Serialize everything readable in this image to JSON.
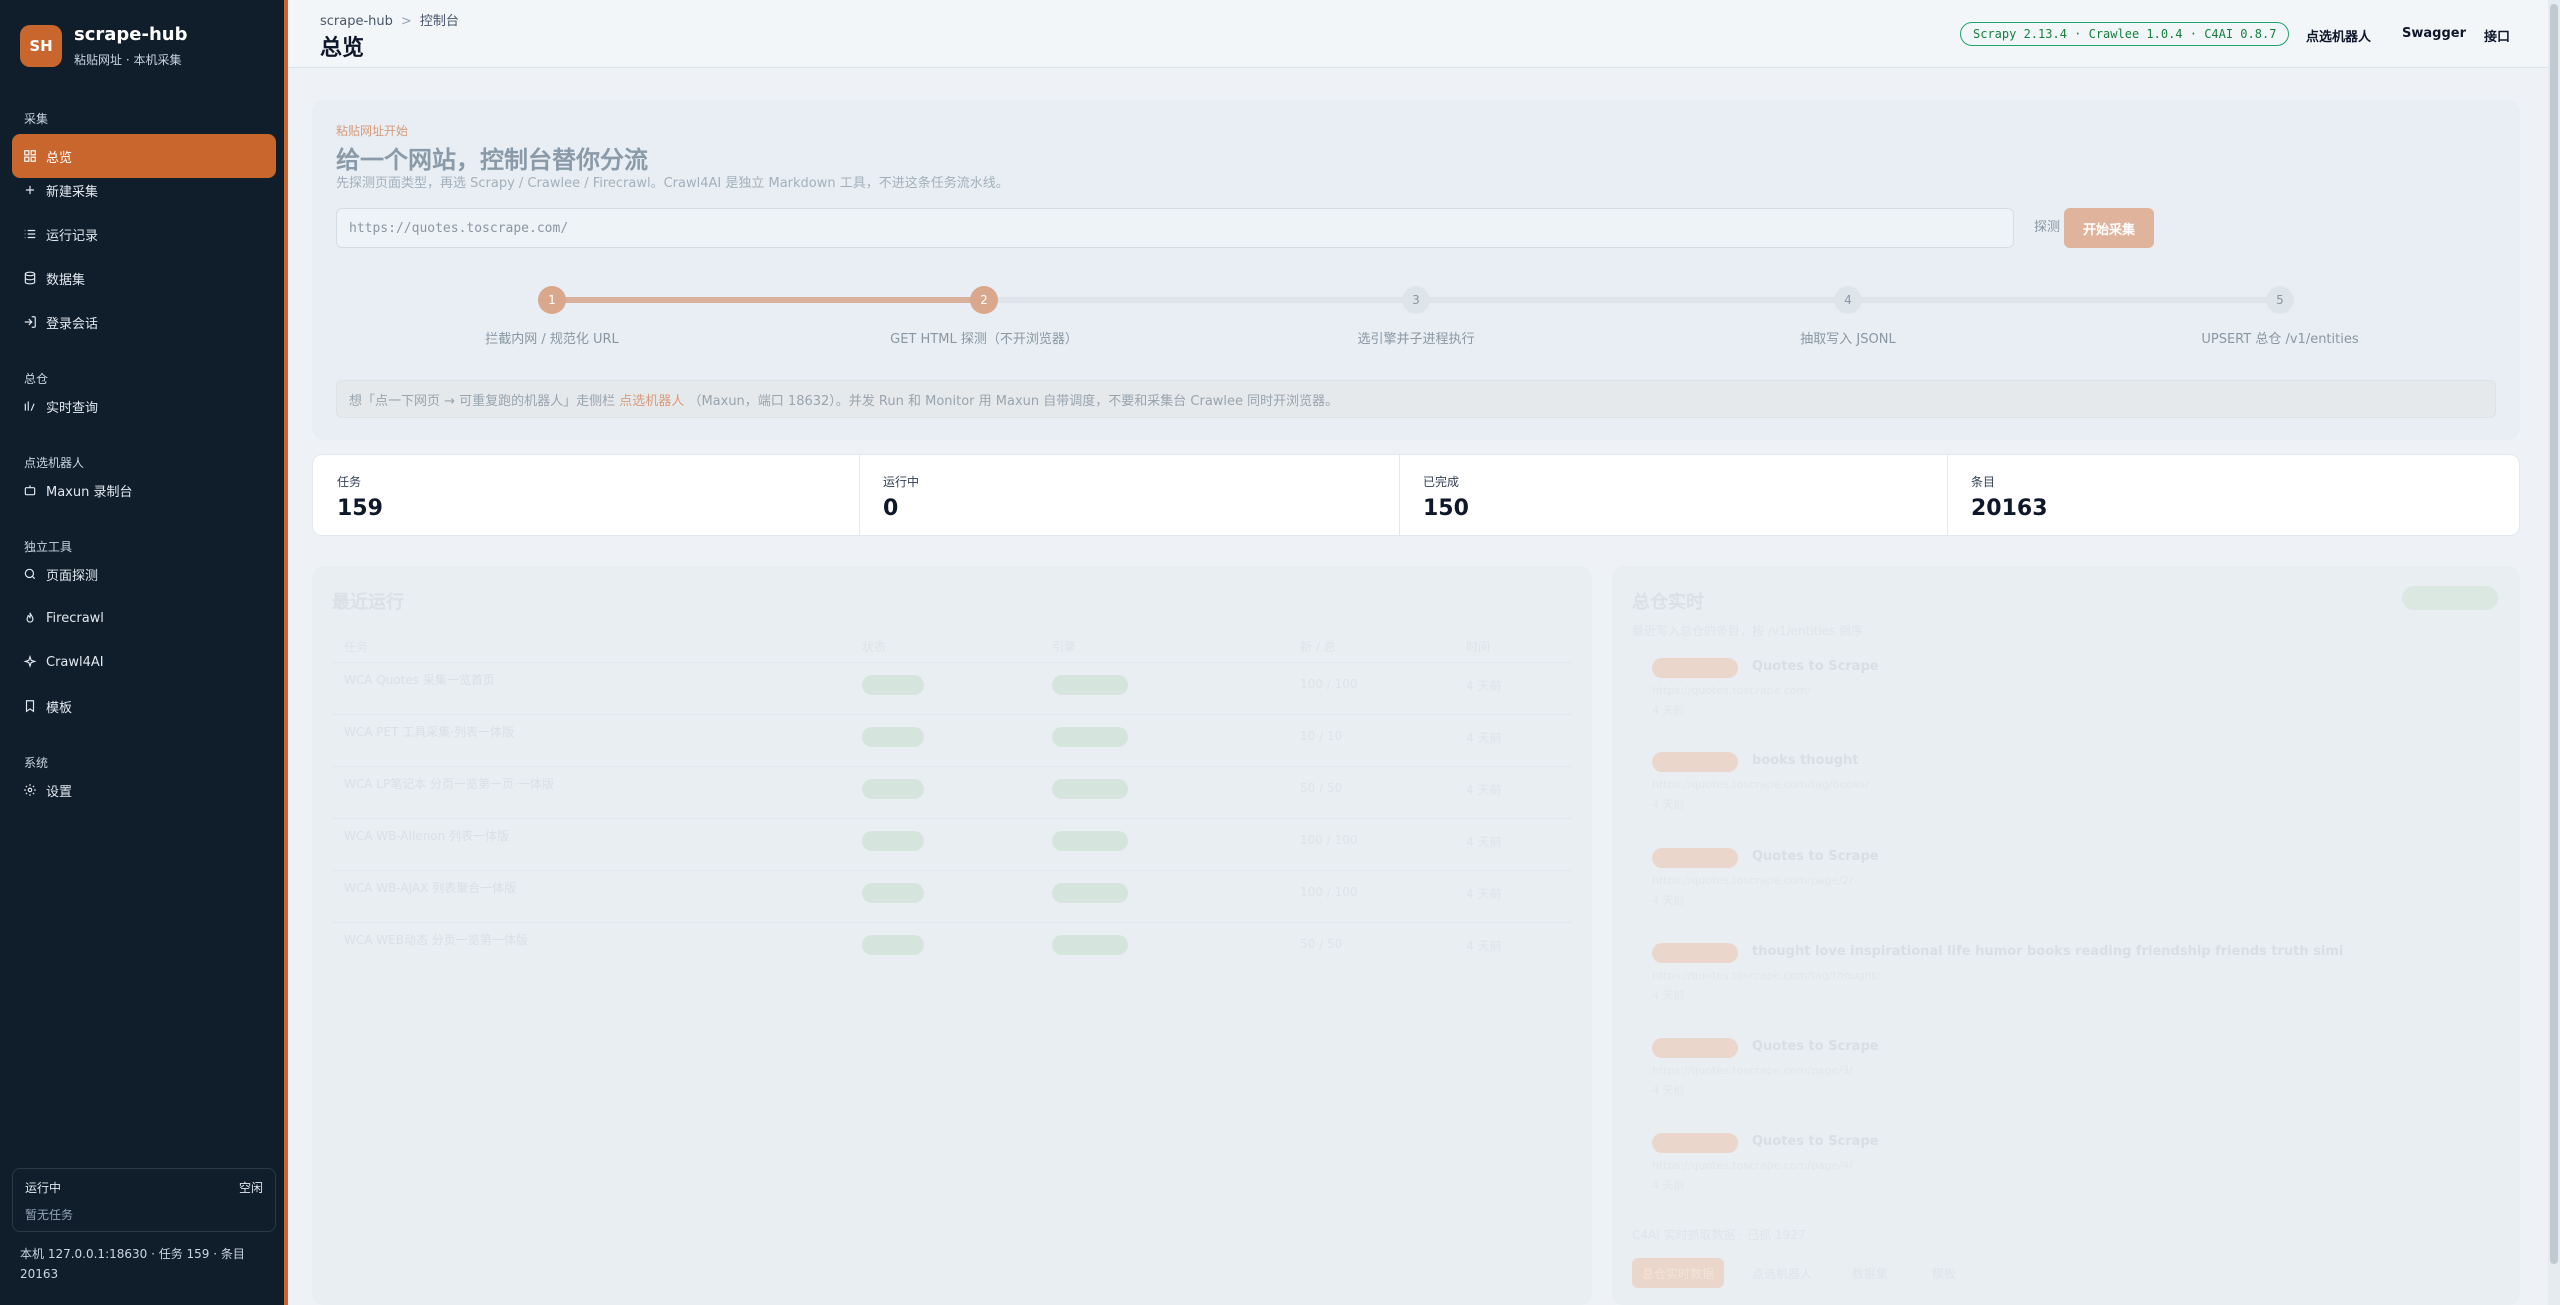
{
  "brand": {
    "logo": "SH",
    "name": "scrape-hub",
    "subtitle": "粘贴网址 · 本机采集"
  },
  "sidebar": {
    "sections": [
      {
        "title": "采集",
        "items": [
          {
            "label": "总览",
            "icon": "dashboard-icon",
            "active": true
          },
          {
            "label": "新建采集",
            "icon": "plus-icon"
          },
          {
            "label": "运行记录",
            "icon": "list-icon"
          },
          {
            "label": "数据集",
            "icon": "database-icon"
          },
          {
            "label": "登录会话",
            "icon": "login-icon"
          }
        ]
      },
      {
        "title": "总仓",
        "items": [
          {
            "label": "实时查询",
            "icon": "stats-icon"
          }
        ]
      },
      {
        "title": "点选机器人",
        "items": [
          {
            "label": "Maxun 录制台",
            "icon": "robot-icon"
          }
        ]
      },
      {
        "title": "独立工具",
        "items": [
          {
            "label": "页面探测",
            "icon": "search-icon"
          },
          {
            "label": "Firecrawl",
            "icon": "flame-icon"
          },
          {
            "label": "Crawl4AI",
            "icon": "sparkle-icon"
          },
          {
            "label": "模板",
            "icon": "bookmark-icon"
          }
        ]
      },
      {
        "title": "系统",
        "items": [
          {
            "label": "设置",
            "icon": "gear-icon"
          }
        ]
      }
    ],
    "running": {
      "label": "运行中",
      "state": "空闲",
      "empty": "暂无任务"
    },
    "footer": "本机 127.0.0.1:18630 · 任务 159 · 条目 20163"
  },
  "topbar": {
    "breadcrumb": [
      "scrape-hub",
      "控制台"
    ],
    "title": "总览",
    "version": "Scrapy 2.13.4 · Crawlee 1.0.4 · C4AI 0.8.7",
    "links": [
      "点选机器人",
      "Swagger",
      "接口"
    ]
  },
  "hero": {
    "kicker": "粘贴网址开始",
    "title": "给一个网站，控制台替你分流",
    "desc": "先探测页面类型，再选 Scrapy / Crawlee / Firecrawl。Crawl4AI 是独立 Markdown 工具，不进这条任务流水线。",
    "url_value": "https://quotes.toscrape.com/",
    "probe_label": "探测",
    "start_label": "开始采集",
    "steps": [
      {
        "n": "1",
        "label": "拦截内网 / 规范化 URL",
        "done": true
      },
      {
        "n": "2",
        "label": "GET HTML 探测（不开浏览器）",
        "done": true
      },
      {
        "n": "3",
        "label": "选引擎并子进程执行",
        "done": false
      },
      {
        "n": "4",
        "label": "抽取写入 JSONL",
        "done": false
      },
      {
        "n": "5",
        "label": "UPSERT 总仓 /v1/entities",
        "done": false
      }
    ],
    "hint_pre": "想「点一下网页 → 可重复跑的机器人」走侧栏 ",
    "hint_link": "点选机器人",
    "hint_post": " （Maxun，端口 18632）。并发 Run 和 Monitor 用 Maxun 自带调度，不要和采集台 Crawlee 同时开浏览器。"
  },
  "stats": [
    {
      "label": "任务",
      "value": "159"
    },
    {
      "label": "运行中",
      "value": "0"
    },
    {
      "label": "已完成",
      "value": "150"
    },
    {
      "label": "条目",
      "value": "20163"
    }
  ],
  "recent": {
    "title": "最近运行",
    "headers": [
      "任务",
      "状态",
      "引擎",
      "新 / 总",
      "时间"
    ],
    "rows": [
      {
        "task": "WCA Quotes 采集一览首页",
        "count": "100 / 100",
        "ago": "4 天前"
      },
      {
        "task": "WCA PET 工具采集·列表一体版",
        "count": "10 / 10",
        "ago": "4 天前"
      },
      {
        "task": "WCA LP笔记本 分页一览第一页·一体版",
        "count": "50 / 50",
        "ago": "4 天前"
      },
      {
        "task": "WCA WB-Allenon 列表一体版",
        "count": "100 / 100",
        "ago": "4 天前"
      },
      {
        "task": "WCA WB-AJAX 列表聚合一体版",
        "count": "100 / 100",
        "ago": "4 天前"
      },
      {
        "task": "WCA WEB动态 分页一览第一体版",
        "count": "50 / 50",
        "ago": "4 天前"
      }
    ]
  },
  "live": {
    "title": "总仓实时",
    "desc": "最近写入总仓的条目，按 /v1/entities 倒序",
    "entities": [
      {
        "title": "Quotes to Scrape",
        "url": "https://quotes.toscrape.com/",
        "ago": "4 天前"
      },
      {
        "title": "books thought",
        "url": "https://quotes.toscrape.com/tag/books/",
        "ago": "4 天前"
      },
      {
        "title": "Quotes to Scrape",
        "url": "https://quotes.toscrape.com/page/2/",
        "ago": "4 天前"
      },
      {
        "title": "thought love inspirational life humor books reading friendship friends truth simi",
        "url": "https://quotes.toscrape.com/tag/thought/",
        "ago": "4 天前"
      },
      {
        "title": "Quotes to Scrape",
        "url": "https://quotes.toscrape.com/page/3/",
        "ago": "4 天前"
      },
      {
        "title": "Quotes to Scrape",
        "url": "https://quotes.toscrape.com/page/4/",
        "ago": "4 天前"
      }
    ],
    "foot": "C4AI 实时抓取数据 · 已抓 1927",
    "tabs": [
      "总仓实时数据",
      "点选机器人",
      "数据集",
      "模板"
    ]
  },
  "colors": {
    "accent": "#c8662e",
    "sidebar_bg": "#0f1e2a",
    "version_green": "#22a36b"
  }
}
